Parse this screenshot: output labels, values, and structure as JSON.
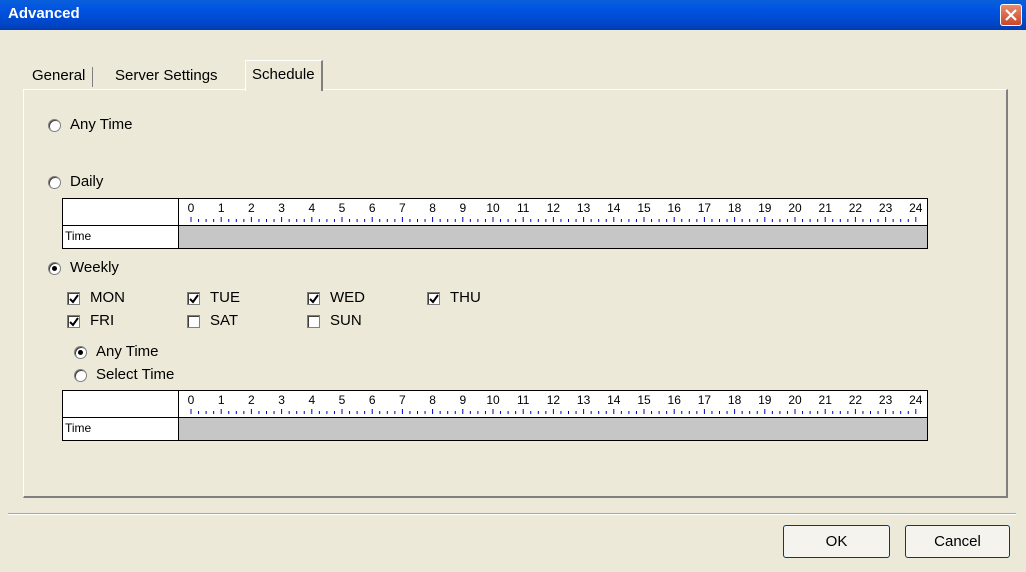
{
  "window": {
    "title": "Advanced"
  },
  "tabs": [
    {
      "label": "General"
    },
    {
      "label": "Server Settings"
    },
    {
      "label": "Schedule",
      "active": true
    }
  ],
  "schedule": {
    "any_time": {
      "label": "Any Time",
      "selected": false
    },
    "daily": {
      "label": "Daily",
      "selected": false
    },
    "weekly": {
      "label": "Weekly",
      "selected": true
    },
    "days": [
      {
        "label": "MON",
        "checked": true
      },
      {
        "label": "TUE",
        "checked": true
      },
      {
        "label": "WED",
        "checked": true
      },
      {
        "label": "THU",
        "checked": true
      },
      {
        "label": "FRI",
        "checked": true
      },
      {
        "label": "SAT",
        "checked": false
      },
      {
        "label": "SUN",
        "checked": false
      }
    ],
    "weekly_any_time": {
      "label": "Any Time",
      "selected": true
    },
    "weekly_select_time": {
      "label": "Select Time",
      "selected": false
    },
    "time_row_label": "Time",
    "hours": [
      "0",
      "1",
      "2",
      "3",
      "4",
      "5",
      "6",
      "7",
      "8",
      "9",
      "10",
      "11",
      "12",
      "13",
      "14",
      "15",
      "16",
      "17",
      "18",
      "19",
      "20",
      "21",
      "22",
      "23",
      "24"
    ]
  },
  "buttons": {
    "ok": "OK",
    "cancel": "Cancel"
  },
  "colors": {
    "titlebar": "#0054E3",
    "dialog_bg": "#ECE9D8",
    "ruler_ticks": "#0000C0",
    "time_bar": "#C6C6C6"
  }
}
